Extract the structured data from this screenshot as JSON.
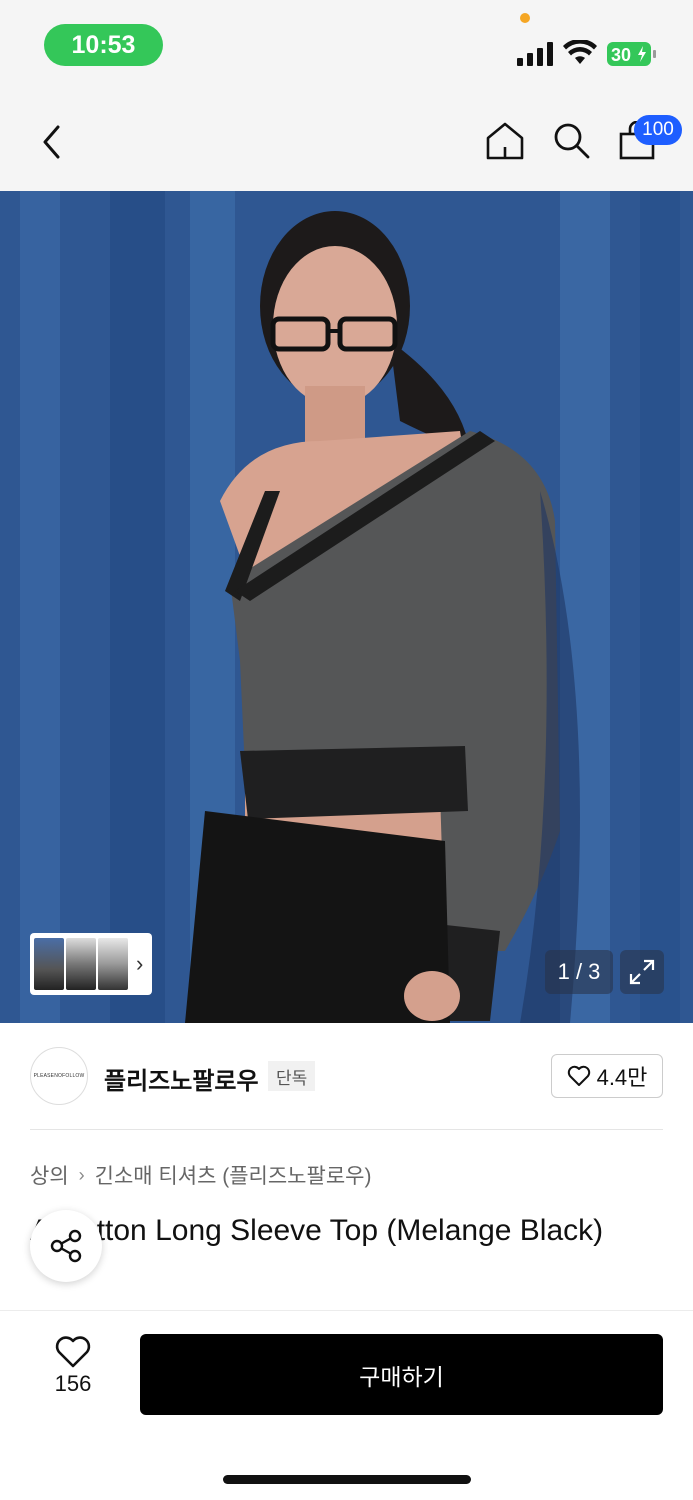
{
  "status_bar": {
    "time": "10:53",
    "battery_level": "30",
    "colors": {
      "time_pill": "#34c759",
      "battery": "#34c759",
      "privacy_dot": "#f5a623"
    }
  },
  "header": {
    "icons": [
      "chevron-left-icon",
      "home-icon",
      "search-icon",
      "shopping-bag-icon"
    ],
    "cart_count": "100",
    "accent_color": "#1e5eff"
  },
  "gallery": {
    "page_indicator": "1 / 3",
    "current_page": 1,
    "total_pages": 3,
    "thumb_count": 3
  },
  "brand": {
    "logo_text": "PLEASENOFOLLOW",
    "name": "플리즈노팔로우",
    "badge": "단독",
    "likes": "4.4만"
  },
  "breadcrumb": {
    "items": [
      "상의",
      "긴소매 티셔츠 (플리즈노팔로우)"
    ]
  },
  "product": {
    "title": "A-Button Long Sleeve Top (Melange Black)"
  },
  "bottom_bar": {
    "wish_count": "156",
    "buy_label": "구매하기"
  }
}
